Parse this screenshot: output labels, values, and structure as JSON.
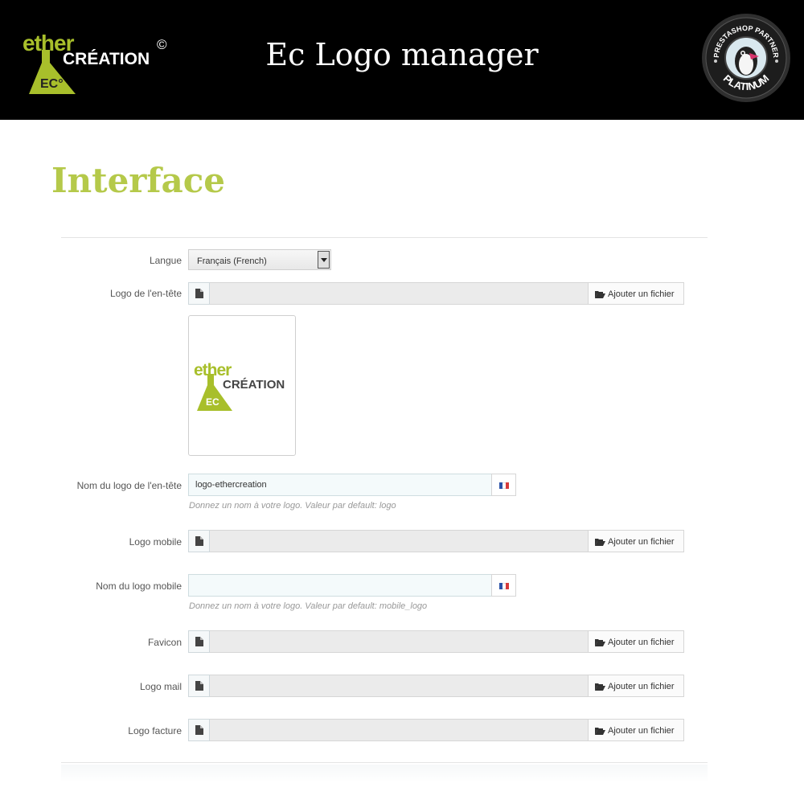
{
  "banner": {
    "title": "Ec Logo manager",
    "brand_ether": "ether",
    "brand_creation": "CRÉATION",
    "brand_copyright": "©",
    "brand_ec": "EC°",
    "badge_top": "PRESTASHOP PARTNER",
    "badge_bottom": "PLATINUM"
  },
  "section": {
    "title": "Interface"
  },
  "form": {
    "langue": {
      "label": "Langue",
      "value": "Français (French)"
    },
    "logo_header": {
      "label": "Logo de l'en-tête",
      "button": "Ajouter un fichier"
    },
    "preview": {
      "ether": "ether",
      "creation": "CRÉATION",
      "ec": "EC"
    },
    "logo_header_name": {
      "label": "Nom du logo de l'en-tête",
      "value": "logo-ethercreation",
      "help": "Donnez un nom à votre logo. Valeur par default: logo"
    },
    "logo_mobile": {
      "label": "Logo mobile",
      "button": "Ajouter un fichier"
    },
    "logo_mobile_name": {
      "label": "Nom du logo mobile",
      "value": "",
      "help": "Donnez un nom à votre logo. Valeur par default: mobile_logo"
    },
    "favicon": {
      "label": "Favicon",
      "button": "Ajouter un fichier"
    },
    "logo_mail": {
      "label": "Logo mail",
      "button": "Ajouter un fichier"
    },
    "logo_invoice": {
      "label": "Logo facture",
      "button": "Ajouter un fichier"
    }
  },
  "colors": {
    "accent_green": "#b5c94a",
    "brand_green": "#a8bf2b",
    "banner_bg": "#000000"
  },
  "icons": {
    "file": "file-icon",
    "folder_open": "folder-open-icon",
    "flag": "flag-fr-icon",
    "dropdown": "chevron-down-icon"
  }
}
